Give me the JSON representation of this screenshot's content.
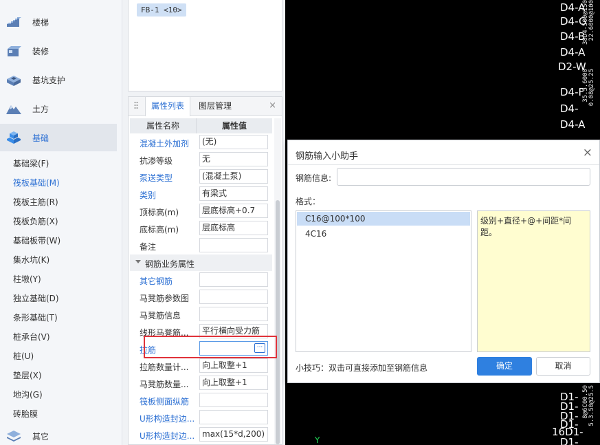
{
  "nav": {
    "categories": [
      {
        "label": "楼梯",
        "icon": "stairs-icon"
      },
      {
        "label": "装修",
        "icon": "decoration-icon"
      },
      {
        "label": "基坑支护",
        "icon": "pit-support-icon"
      },
      {
        "label": "土方",
        "icon": "earthwork-icon"
      },
      {
        "label": "基础",
        "icon": "foundation-icon"
      },
      {
        "label": "其它",
        "icon": "other-icon"
      }
    ],
    "active_category": "基础",
    "sub_items": [
      "基础梁(F)",
      "筏板基础(M)",
      "筏板主筋(R)",
      "筏板负筋(X)",
      "基础板带(W)",
      "集水坑(K)",
      "柱墩(Y)",
      "独立基础(D)",
      "条形基础(T)",
      "桩承台(V)",
      "桩(U)",
      "垫层(X)",
      "地沟(G)",
      "砖胎膜"
    ],
    "selected_sub": "筏板基础(M)",
    "accent_color": "#2b6fd3"
  },
  "layer_list": {
    "tag": "FB-1 <10>"
  },
  "props_panel": {
    "tab_active": "属性列表",
    "tab_other": "图层管理",
    "close_glyph": "×",
    "header_name": "属性名称",
    "header_value": "属性值",
    "rows": [
      {
        "name": "混凝土外加剂",
        "value": "(无)",
        "link": true
      },
      {
        "name": "抗渗等级",
        "value": "无",
        "link": false
      },
      {
        "name": "泵送类型",
        "value": "(混凝土泵)",
        "link": true
      },
      {
        "name": "类别",
        "value": "有梁式",
        "link": true
      },
      {
        "name": "顶标高(m)",
        "value": "层底标高+0.7",
        "link": false
      },
      {
        "name": "底标高(m)",
        "value": "层底标高",
        "link": false
      },
      {
        "name": "备注",
        "value": "",
        "link": false
      }
    ],
    "group": "钢筋业务属性",
    "group_rows": [
      {
        "name": "其它钢筋",
        "value": "",
        "link": true
      },
      {
        "name": "马凳筋参数图",
        "value": "",
        "link": false
      },
      {
        "name": "马凳筋信息",
        "value": "",
        "link": false
      },
      {
        "name": "线形马凳筋...",
        "value": "平行横向受力筋",
        "link": false
      },
      {
        "name": "拉筋",
        "value": "",
        "link": true,
        "editing": true
      },
      {
        "name": "拉筋数量计...",
        "value": "向上取整+1",
        "link": false
      },
      {
        "name": "马凳筋数量...",
        "value": "向上取整+1",
        "link": false
      },
      {
        "name": "筏板侧面纵筋",
        "value": "",
        "link": true
      },
      {
        "name": "U形构造封边...",
        "value": "",
        "link": true
      },
      {
        "name": "U形构造封边...",
        "value": "max(15*d,200)",
        "link": true
      }
    ],
    "ellipsis_button": "···",
    "highlight_color": "#e0323a"
  },
  "cad": {
    "labels": [
      "D4-A",
      "D4-G",
      "D4-B",
      "D4-A",
      "D2-W",
      "D4-F",
      "D4-",
      "D4-A",
      "D1-",
      "D1-",
      "D1-",
      "D1-",
      "16D1-",
      "D1-"
    ],
    "vertical_text": [
      "38D4-500@150",
      "22.6000@100",
      "35.5.6000",
      "0.08@25.25",
      "8@6C00.50",
      "5.3.50@25.5"
    ],
    "axis_label": "Y",
    "background": "#000000"
  },
  "dialog": {
    "title": "钢筋输入小助手",
    "close_glyph": "×",
    "info_label": "钢筋信息:",
    "info_value": "",
    "format_label": "格式：",
    "formats": [
      "C16@100*100",
      "4C16"
    ],
    "selected_format": "C16@100*100",
    "description": "级别+直径+@+间距*间距。",
    "tip": "小技巧：双击可直接添加至钢筋信息",
    "ok_label": "确定",
    "cancel_label": "取消",
    "ok_color": "#2f80e0",
    "description_bg": "#fffdd0"
  }
}
